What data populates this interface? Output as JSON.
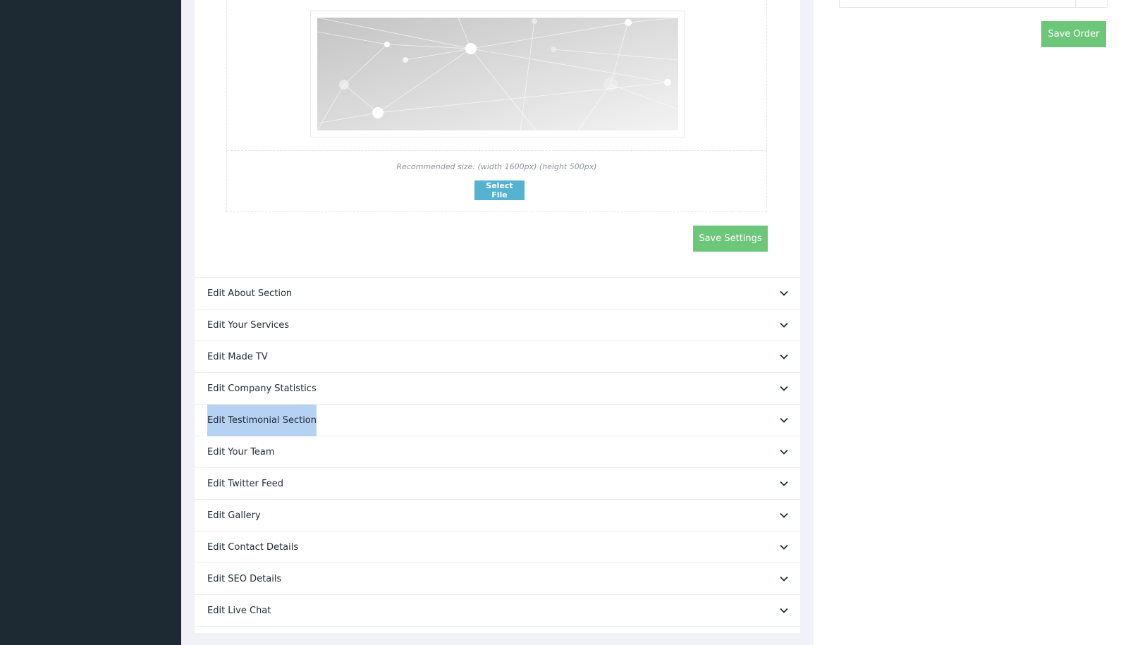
{
  "upload": {
    "hint": "Recommended size: (width 1600px) (height 500px)",
    "select_label": "Select File"
  },
  "actions": {
    "save_settings_label": "Save Settings",
    "save_order_label": "Save Order"
  },
  "accordion": {
    "items": [
      {
        "label": "Edit About Section"
      },
      {
        "label": "Edit Your Services"
      },
      {
        "label": "Edit Made TV"
      },
      {
        "label": "Edit Company Statistics"
      },
      {
        "label": "Edit Testimonial Section",
        "selected": true
      },
      {
        "label": "Edit Your Team"
      },
      {
        "label": "Edit Twitter Feed"
      },
      {
        "label": "Edit Gallery"
      },
      {
        "label": "Edit Contact Details"
      },
      {
        "label": "Edit SEO Details"
      },
      {
        "label": "Edit Live Chat"
      }
    ],
    "chevron_icon": "chevron-down-icon"
  },
  "colors": {
    "sidebar": "#1e2a33",
    "content_background": "#f0f2f8",
    "select_button": "#55b3d1",
    "save_button": "#6dc77a",
    "selection_highlight": "#b6d2f3"
  }
}
